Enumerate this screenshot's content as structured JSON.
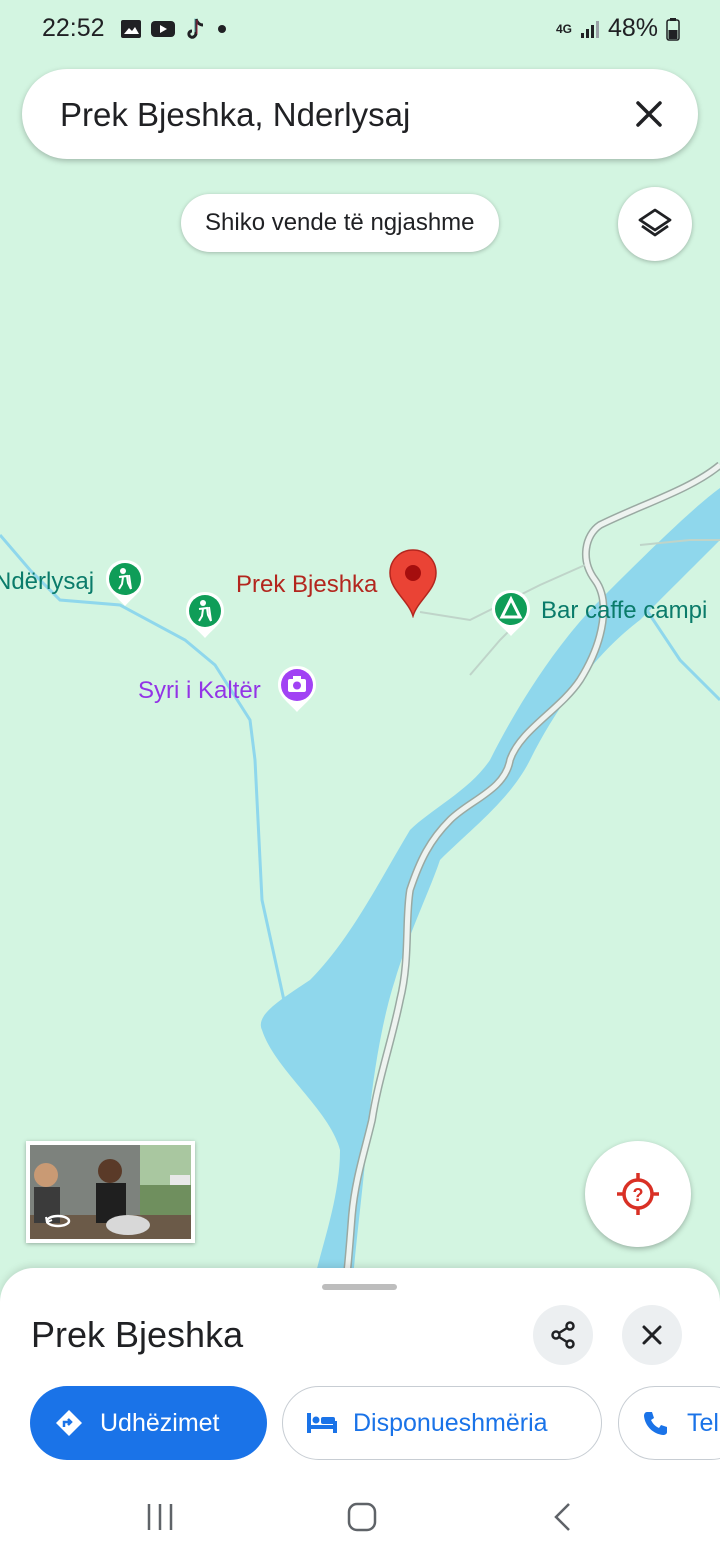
{
  "status_bar": {
    "time": "22:52",
    "notification_icons": [
      "gallery-icon",
      "youtube-icon",
      "tiktok-icon",
      "dot-icon"
    ],
    "network": "4G",
    "battery": "48%"
  },
  "search": {
    "query": "Prek Bjeshka, Nderlysaj"
  },
  "map": {
    "similar_places_label": "Shiko vende të ngjashme",
    "places": [
      {
        "name": "Ndërlysaj",
        "color": "#0a7b6a",
        "icon": "hiking-icon"
      },
      {
        "name": "Prek Bjeshka",
        "color": "#b3261e",
        "icon": "red-pin-icon"
      },
      {
        "name": "Bar caffe campi",
        "color": "#0a7b6a",
        "icon": "campground-icon"
      },
      {
        "name": "Syri i Kaltër",
        "color": "#9334e6",
        "icon": "camera-icon"
      }
    ],
    "colors": {
      "land": "#d3f5e1",
      "water": "#8fd7ec",
      "road": "#c6d1cc"
    }
  },
  "sheet": {
    "title": "Prek Bjeshka",
    "actions": [
      {
        "label": "Udhëzimet",
        "icon": "directions-icon"
      },
      {
        "label": "Disponueshmëria",
        "icon": "bed-icon"
      },
      {
        "label": "Tel",
        "icon": "phone-icon"
      }
    ]
  },
  "colors": {
    "accent": "#1a73e8",
    "pin": "#ea4335"
  }
}
